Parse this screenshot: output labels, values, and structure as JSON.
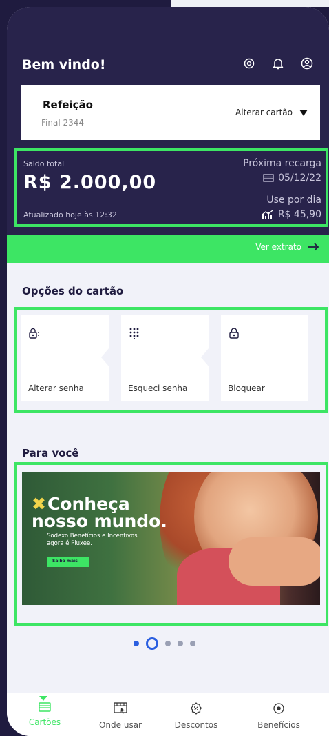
{
  "header": {
    "greeting": "Bem vindo!"
  },
  "card": {
    "name": "Refeição",
    "final": "Final 2344",
    "change_label": "Alterar cartão"
  },
  "balance": {
    "label": "Saldo total",
    "amount": "R$ 2.000,00",
    "updated": "Atualizado hoje às 12:32",
    "next_recharge_label": "Próxima recarga",
    "next_recharge_date": "05/12/22",
    "use_per_day_label": "Use por dia",
    "use_per_day_value": "R$ 45,90"
  },
  "extrato": {
    "label": "Ver extrato"
  },
  "options": {
    "title": "Opções do cartão",
    "items": [
      {
        "label": "Alterar senha",
        "icon": "lock-key-icon"
      },
      {
        "label": "Esqueci senha",
        "icon": "keypad-icon"
      },
      {
        "label": "Bloquear",
        "icon": "lock-icon"
      }
    ]
  },
  "for_you": {
    "title": "Para você",
    "banner_title_line1": "Conheça",
    "banner_title_line2": "nosso mundo.",
    "banner_subtitle_line1": "Sodexo Benefícios e Incentivos",
    "banner_subtitle_line2": "agora é Pluxee.",
    "banner_button": "Saiba mais"
  },
  "carousel": {
    "count": 5,
    "active_index": 1
  },
  "nav": {
    "items": [
      {
        "label": "Cartões",
        "icon": "card-icon"
      },
      {
        "label": "Onde usar",
        "icon": "map-icon"
      },
      {
        "label": "Descontos",
        "icon": "discount-icon"
      },
      {
        "label": "Benefícios",
        "icon": "star-circle-icon"
      }
    ],
    "active_index": 0
  },
  "colors": {
    "brand_dark": "#28234b",
    "accent_green": "#3de564",
    "dot_blue": "#2b5fe0"
  }
}
